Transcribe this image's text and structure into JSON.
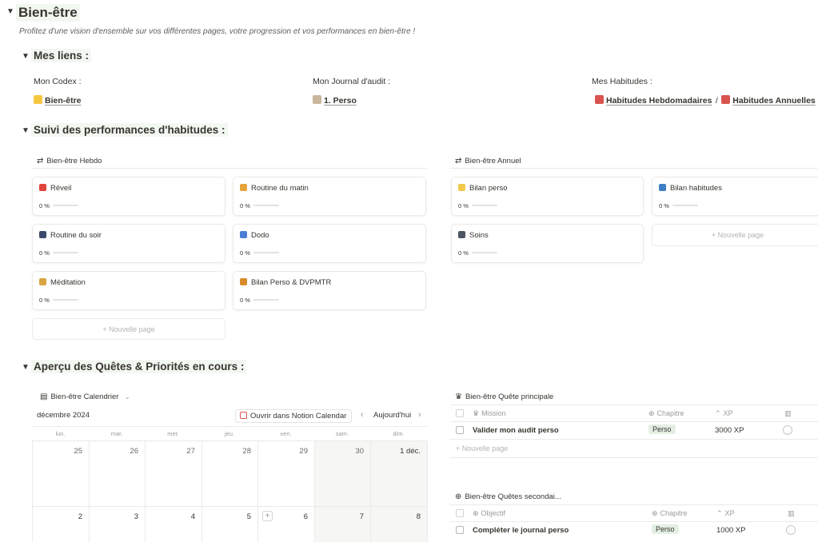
{
  "page": {
    "title": "Bien-être",
    "subtitle": "Profitez d'une vision d'ensemble sur vos différentes pages, votre progression et vos performances en bien-être !"
  },
  "links": {
    "heading": "Mes liens :",
    "codex": {
      "label": "Mon Codex :",
      "link": "Bien-être"
    },
    "journal": {
      "label": "Mon Journal d'audit :",
      "link": "1. Perso"
    },
    "habits": {
      "label": "Mes Habitudes :",
      "link1": "Habitudes Hebdomadaires",
      "sep": "/",
      "link2": "Habitudes Annuelles"
    }
  },
  "perf": {
    "heading": "Suivi des performances d'habitudes :",
    "hebdo": {
      "title": "Bien-être Hebdo",
      "cards": [
        {
          "name": "Réveil",
          "pct": "0 %",
          "progress": 0,
          "color": "#e0443a"
        },
        {
          "name": "Routine du matin",
          "pct": "0 %",
          "progress": 0,
          "color": "#e6a23c"
        },
        {
          "name": "Routine du soir",
          "pct": "0 %",
          "progress": 0,
          "color": "#3b4a6b"
        },
        {
          "name": "Dodo",
          "pct": "0 %",
          "progress": 0,
          "color": "#4a7fd6"
        },
        {
          "name": "Méditation",
          "pct": "0 %",
          "progress": 0,
          "color": "#d9a441"
        },
        {
          "name": "Bilan Perso & DVPMTR",
          "pct": "0 %",
          "progress": 0,
          "color": "#d98b2b"
        }
      ],
      "new_page": "+ Nouvelle page"
    },
    "annuel": {
      "title": "Bien-être Annuel",
      "cards": [
        {
          "name": "Bilan perso",
          "pct": "0 %",
          "progress": 0,
          "color": "#f2c94c"
        },
        {
          "name": "Bilan habitudes",
          "pct": "0 %",
          "progress": 0,
          "color": "#3d7ec4"
        },
        {
          "name": "Soins",
          "pct": "0 %",
          "progress": 0,
          "color": "#4b5563"
        }
      ],
      "new_page": "+ Nouvelle page"
    }
  },
  "quests": {
    "heading": "Aperçu des Quêtes & Priorités en cours :",
    "calendar": {
      "title": "Bien-être Calendrier",
      "month": "décembre 2024",
      "open_button": "Ouvrir dans Notion Calendar",
      "today": "Aujourd'hui",
      "prev": "‹",
      "next": "›",
      "weekdays": [
        "lun.",
        "mar.",
        "mer.",
        "jeu.",
        "ven.",
        "sam.",
        "dim."
      ],
      "week1": [
        "25",
        "26",
        "27",
        "28",
        "29",
        "30",
        "1 déc."
      ],
      "week2": [
        "2",
        "3",
        "4",
        "5",
        "6",
        "7",
        "8"
      ]
    },
    "main_quest": {
      "title": "Bien-être Quête principale",
      "col_mission": "Mission",
      "col_chapitre": "Chapitre",
      "col_xp": "XP",
      "row": {
        "mission": "Valider mon audit perso",
        "chapitre": "Perso",
        "xp": "3000 XP"
      },
      "new_page": "+ Nouvelle page"
    },
    "side_quests": {
      "title": "Bien-être Quêtes secondai...",
      "col_objectif": "Objectif",
      "col_chapitre": "Chapitre",
      "col_xp": "XP",
      "row": {
        "objectif": "Compléter le journal perso",
        "chapitre": "Perso",
        "xp": "1000 XP"
      }
    }
  }
}
